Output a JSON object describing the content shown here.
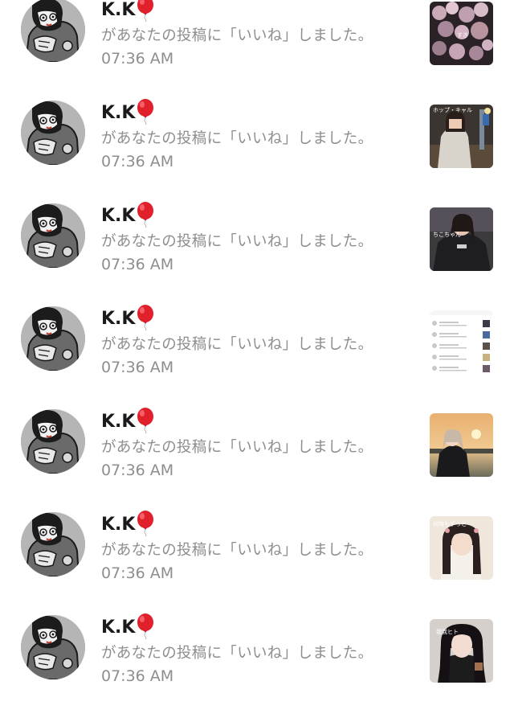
{
  "notifications": [
    {
      "user": "K.K",
      "message": "があなたの投稿に「いいね」しました。",
      "time": "07:36 AM",
      "thumbnail": {
        "icon": "flowers-photo",
        "caption": "すき"
      }
    },
    {
      "user": "K.K",
      "message": "があなたの投稿に「いいね」しました。",
      "time": "07:36 AM",
      "thumbnail": {
        "icon": "girl-street-photo",
        "caption": "ホップ・キャル"
      }
    },
    {
      "user": "K.K",
      "message": "があなたの投稿に「いいね」しました。",
      "time": "07:36 AM",
      "thumbnail": {
        "icon": "girl-night-photo",
        "caption": "ちこちゃん"
      }
    },
    {
      "user": "K.K",
      "message": "があなたの投稿に「いいね」しました。",
      "time": "07:36 AM",
      "thumbnail": {
        "icon": "screenshot-list-photo",
        "caption": ""
      }
    },
    {
      "user": "K.K",
      "message": "があなたの投稿に「いいね」しました。",
      "time": "07:36 AM",
      "thumbnail": {
        "icon": "sunset-girl-photo",
        "caption": ""
      }
    },
    {
      "user": "K.K",
      "message": "があなたの投稿に「いいね」しました。",
      "time": "07:36 AM",
      "thumbnail": {
        "icon": "girl-portrait-photo",
        "caption": "何時もずっと"
      }
    },
    {
      "user": "K.K",
      "message": "があなたの投稿に「いいね」しました。",
      "time": "07:36 AM",
      "thumbnail": {
        "icon": "girl-dark-hair-photo",
        "caption": "我我ヒト"
      }
    }
  ],
  "colors": {
    "name": "#1a1a1a",
    "secondary_text": "#8e8e8e",
    "balloon": "#e0202a",
    "background": "#ffffff"
  }
}
